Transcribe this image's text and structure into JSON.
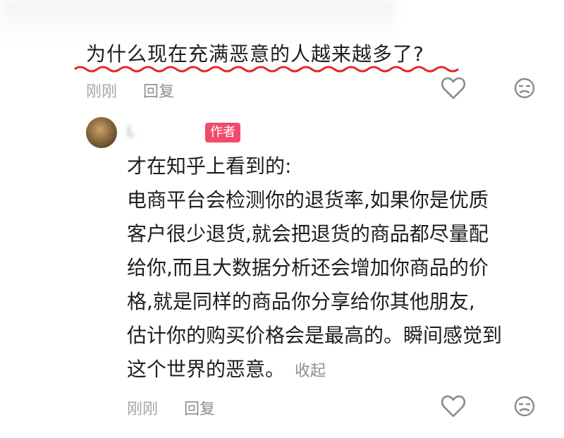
{
  "question": {
    "text": "为什么现在充满恶意的人越来越多了?"
  },
  "question_meta": {
    "time": "刚刚",
    "reply_label": "回复"
  },
  "comment": {
    "author_badge": "作者",
    "lines": [
      "才在知乎上看到的:",
      "电商平台会检测你的退货率,如果你是优质",
      "客户很少退货,就会把退货的商品都尽量配",
      "给你,而且大数据分析还会增加你商品的价",
      "格,就是同样的商品你分享给你其他朋友,",
      "估计你的购买价格会是最高的。瞬间感觉到",
      "这个世界的恶意。"
    ],
    "collapse_label": "收起"
  },
  "comment_meta": {
    "time": "刚刚",
    "reply_label": "回复"
  },
  "icons": [
    "heart-icon",
    "dislike-face-icon"
  ],
  "colors": {
    "badge": "#f04b6a",
    "underline": "#e8262a",
    "meta_text": "#a7a7a7"
  }
}
